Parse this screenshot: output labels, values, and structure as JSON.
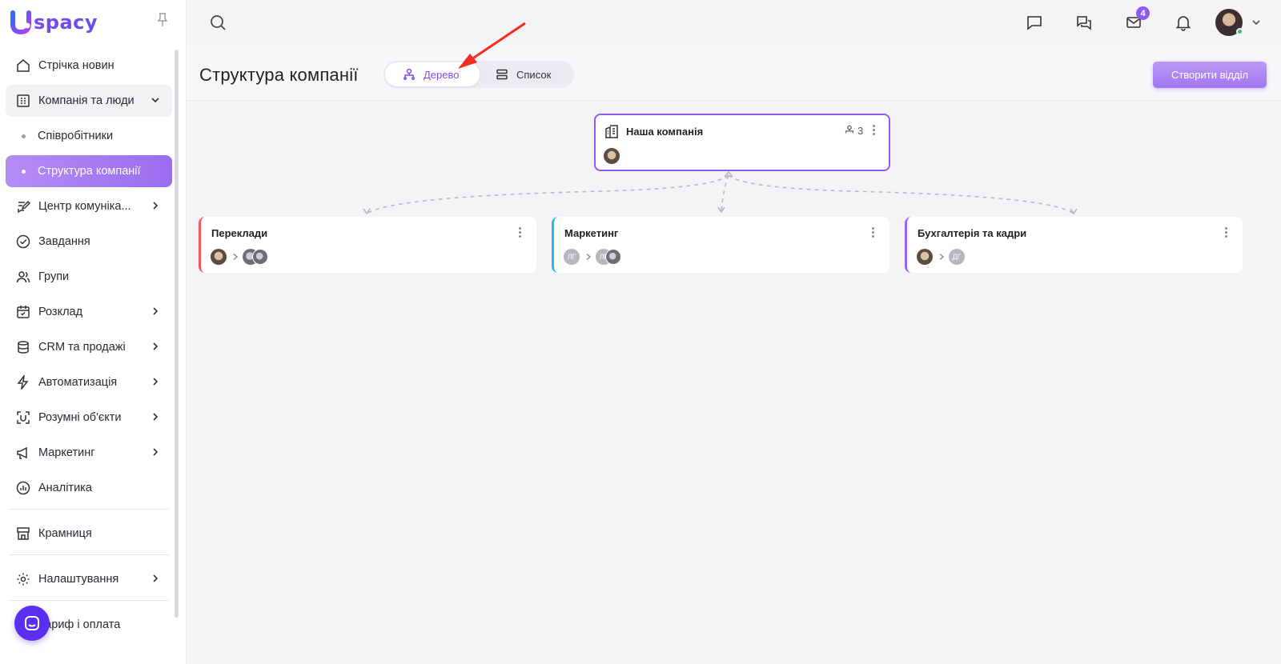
{
  "brand": {
    "logo_letter": "U",
    "logo_text": "spacy",
    "colors": {
      "accent": "#8f5cf2",
      "active_nav": "#a57af1"
    }
  },
  "sidebar": {
    "items": [
      {
        "label": "Стрічка новин",
        "icon": "home-icon"
      },
      {
        "label": "Компанія та люди",
        "icon": "building-icon",
        "expanded": true
      },
      {
        "label": "Співробітники",
        "sub": true
      },
      {
        "label": "Структура компанії",
        "sub": true,
        "active": true
      },
      {
        "label": "Центр комуніка...",
        "icon": "chat-edit-icon"
      },
      {
        "label": "Завдання",
        "icon": "check-circle-icon"
      },
      {
        "label": "Групи",
        "icon": "users-icon"
      },
      {
        "label": "Розклад",
        "icon": "calendar-icon"
      },
      {
        "label": "CRM та продажі",
        "icon": "database-icon"
      },
      {
        "label": "Автоматизація",
        "icon": "lightning-icon"
      },
      {
        "label": "Розумні об'єкти",
        "icon": "scan-icon"
      },
      {
        "label": "Маркетинг",
        "icon": "megaphone-icon"
      },
      {
        "label": "Аналітика",
        "icon": "chart-icon"
      },
      {
        "label": "Крамниця",
        "icon": "store-icon"
      },
      {
        "label": "Налаштування",
        "icon": "gear-icon"
      },
      {
        "label": "Тариф і оплата",
        "icon": "card-icon"
      }
    ]
  },
  "topbar": {
    "mail_badge": "4"
  },
  "header": {
    "title": "Структура компанії",
    "view_tree": "Дерево",
    "view_list": "Список",
    "create_button": "Створити відділ"
  },
  "tree": {
    "root": {
      "title": "Наша компанія",
      "count": "3"
    },
    "departments": [
      {
        "title": "Переклади",
        "color": "#f0565b",
        "avatars": [
          "photo",
          "photo2",
          "photo2"
        ]
      },
      {
        "title": "Маркетинг",
        "color": "#27b8e8",
        "avatars": [
          "ЛГ",
          "ЛГ",
          "photo2"
        ]
      },
      {
        "title": "Бухгалтерія та кадри",
        "color": "#9a62f0",
        "avatars": [
          "photo",
          "ДГ"
        ]
      }
    ]
  }
}
